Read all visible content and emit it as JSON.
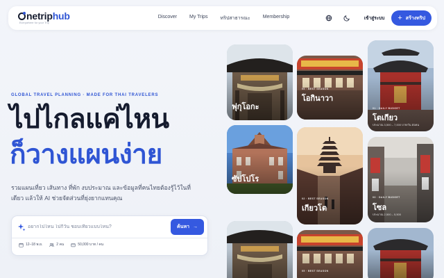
{
  "brand": {
    "name_dark": "netrip",
    "name_blue": "hub",
    "tagline": "Everywhere for your Trip"
  },
  "nav": {
    "items": [
      "Discover",
      "My Trips",
      "ทริปสาธารณะ",
      "Membership"
    ],
    "login": "เข้าสู่ระบบ",
    "cta": "สร้างทริป"
  },
  "hero": {
    "eyebrow": "GLOBAL TRAVEL PLANNING · MADE FOR THAI TRAVELERS",
    "line1": "ไปไกลแค่ไหน",
    "line2": "ก็วางแผนง่าย",
    "desc": "รวมแผนเที่ยว เส้นทาง ที่พัก งบประมาณ และข้อมูลที่คนไทยต้องรู้ไว้ในที่เดียว แล้วให้ AI ช่วยจัดส่วนที่ยุ่งยากแทนคุณ"
  },
  "search": {
    "placeholder": "อยากไปไหน ไปกี่วัน ชอบเที่ยวแบบไหน?",
    "button": "ค้นหา",
    "chips": {
      "dates": "12–18 พ.ย.",
      "people": "2 คน",
      "budget": "50,000 บาท / คน"
    }
  },
  "cards": [
    {
      "city": "ฟุกุโอกะ",
      "meta": "",
      "price": ""
    },
    {
      "city": "ซัปโปโร",
      "meta": "",
      "price": ""
    },
    {
      "city": "",
      "meta": "",
      "price": ""
    },
    {
      "city": "โอกินาวา",
      "meta": "05 · BEST SEASON",
      "price": ""
    },
    {
      "city": "เกียวโต",
      "meta": "02 · BEST SEASON",
      "price": ""
    },
    {
      "city": "",
      "meta": "05 · BEST SEASON",
      "price": ""
    },
    {
      "city": "โตเกียว",
      "meta": "01 · DAILY BUDGET",
      "price": "ประมาณ 3,500 – 7,000 บาท/วัน ต่อคน"
    },
    {
      "city": "โซล",
      "meta": "03 · DAILY BUDGET",
      "price": "ประมาณ 2,500 – 5,500"
    },
    {
      "city": "",
      "meta": "",
      "price": ""
    }
  ],
  "colors": {
    "accent": "#3559e0",
    "ink": "#151b2e"
  }
}
